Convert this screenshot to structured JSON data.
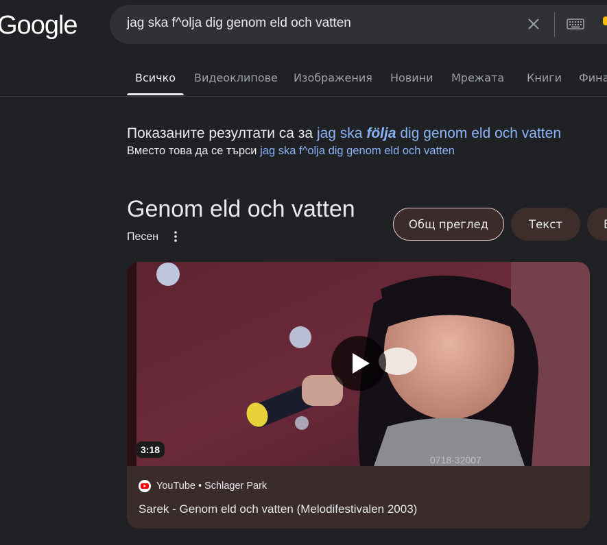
{
  "logo": "Google",
  "search": {
    "query": "jag ska f^olja dig genom eld och vatten"
  },
  "tabs": [
    "Всичко",
    "Видеоклипове",
    "Изображения",
    "Новини",
    "Мрежата",
    "Книги",
    "Финанси"
  ],
  "correction": {
    "prefix": "Показаните резултати са за",
    "corrected_start": "jag ska",
    "corrected_word": "följa",
    "corrected_end": "dig genom eld och vatten",
    "instead_prefix": "Вместо това да се търси",
    "original_query": "jag ska f^olja dig genom eld och vatten"
  },
  "knowledge_panel": {
    "title": "Genom eld och vatten",
    "subtitle": "Песен",
    "chips": [
      "Общ преглед",
      "Текст",
      "В"
    ]
  },
  "video": {
    "duration": "3:18",
    "source": "YouTube • Schlager Park",
    "title": "Sarek - Genom eld och vatten (Melodifestivalen 2003)",
    "overlay_code": "0718-32007"
  },
  "colors": {
    "background": "#202124",
    "link": "#8ab4f8",
    "card": "#3a2c2a"
  }
}
